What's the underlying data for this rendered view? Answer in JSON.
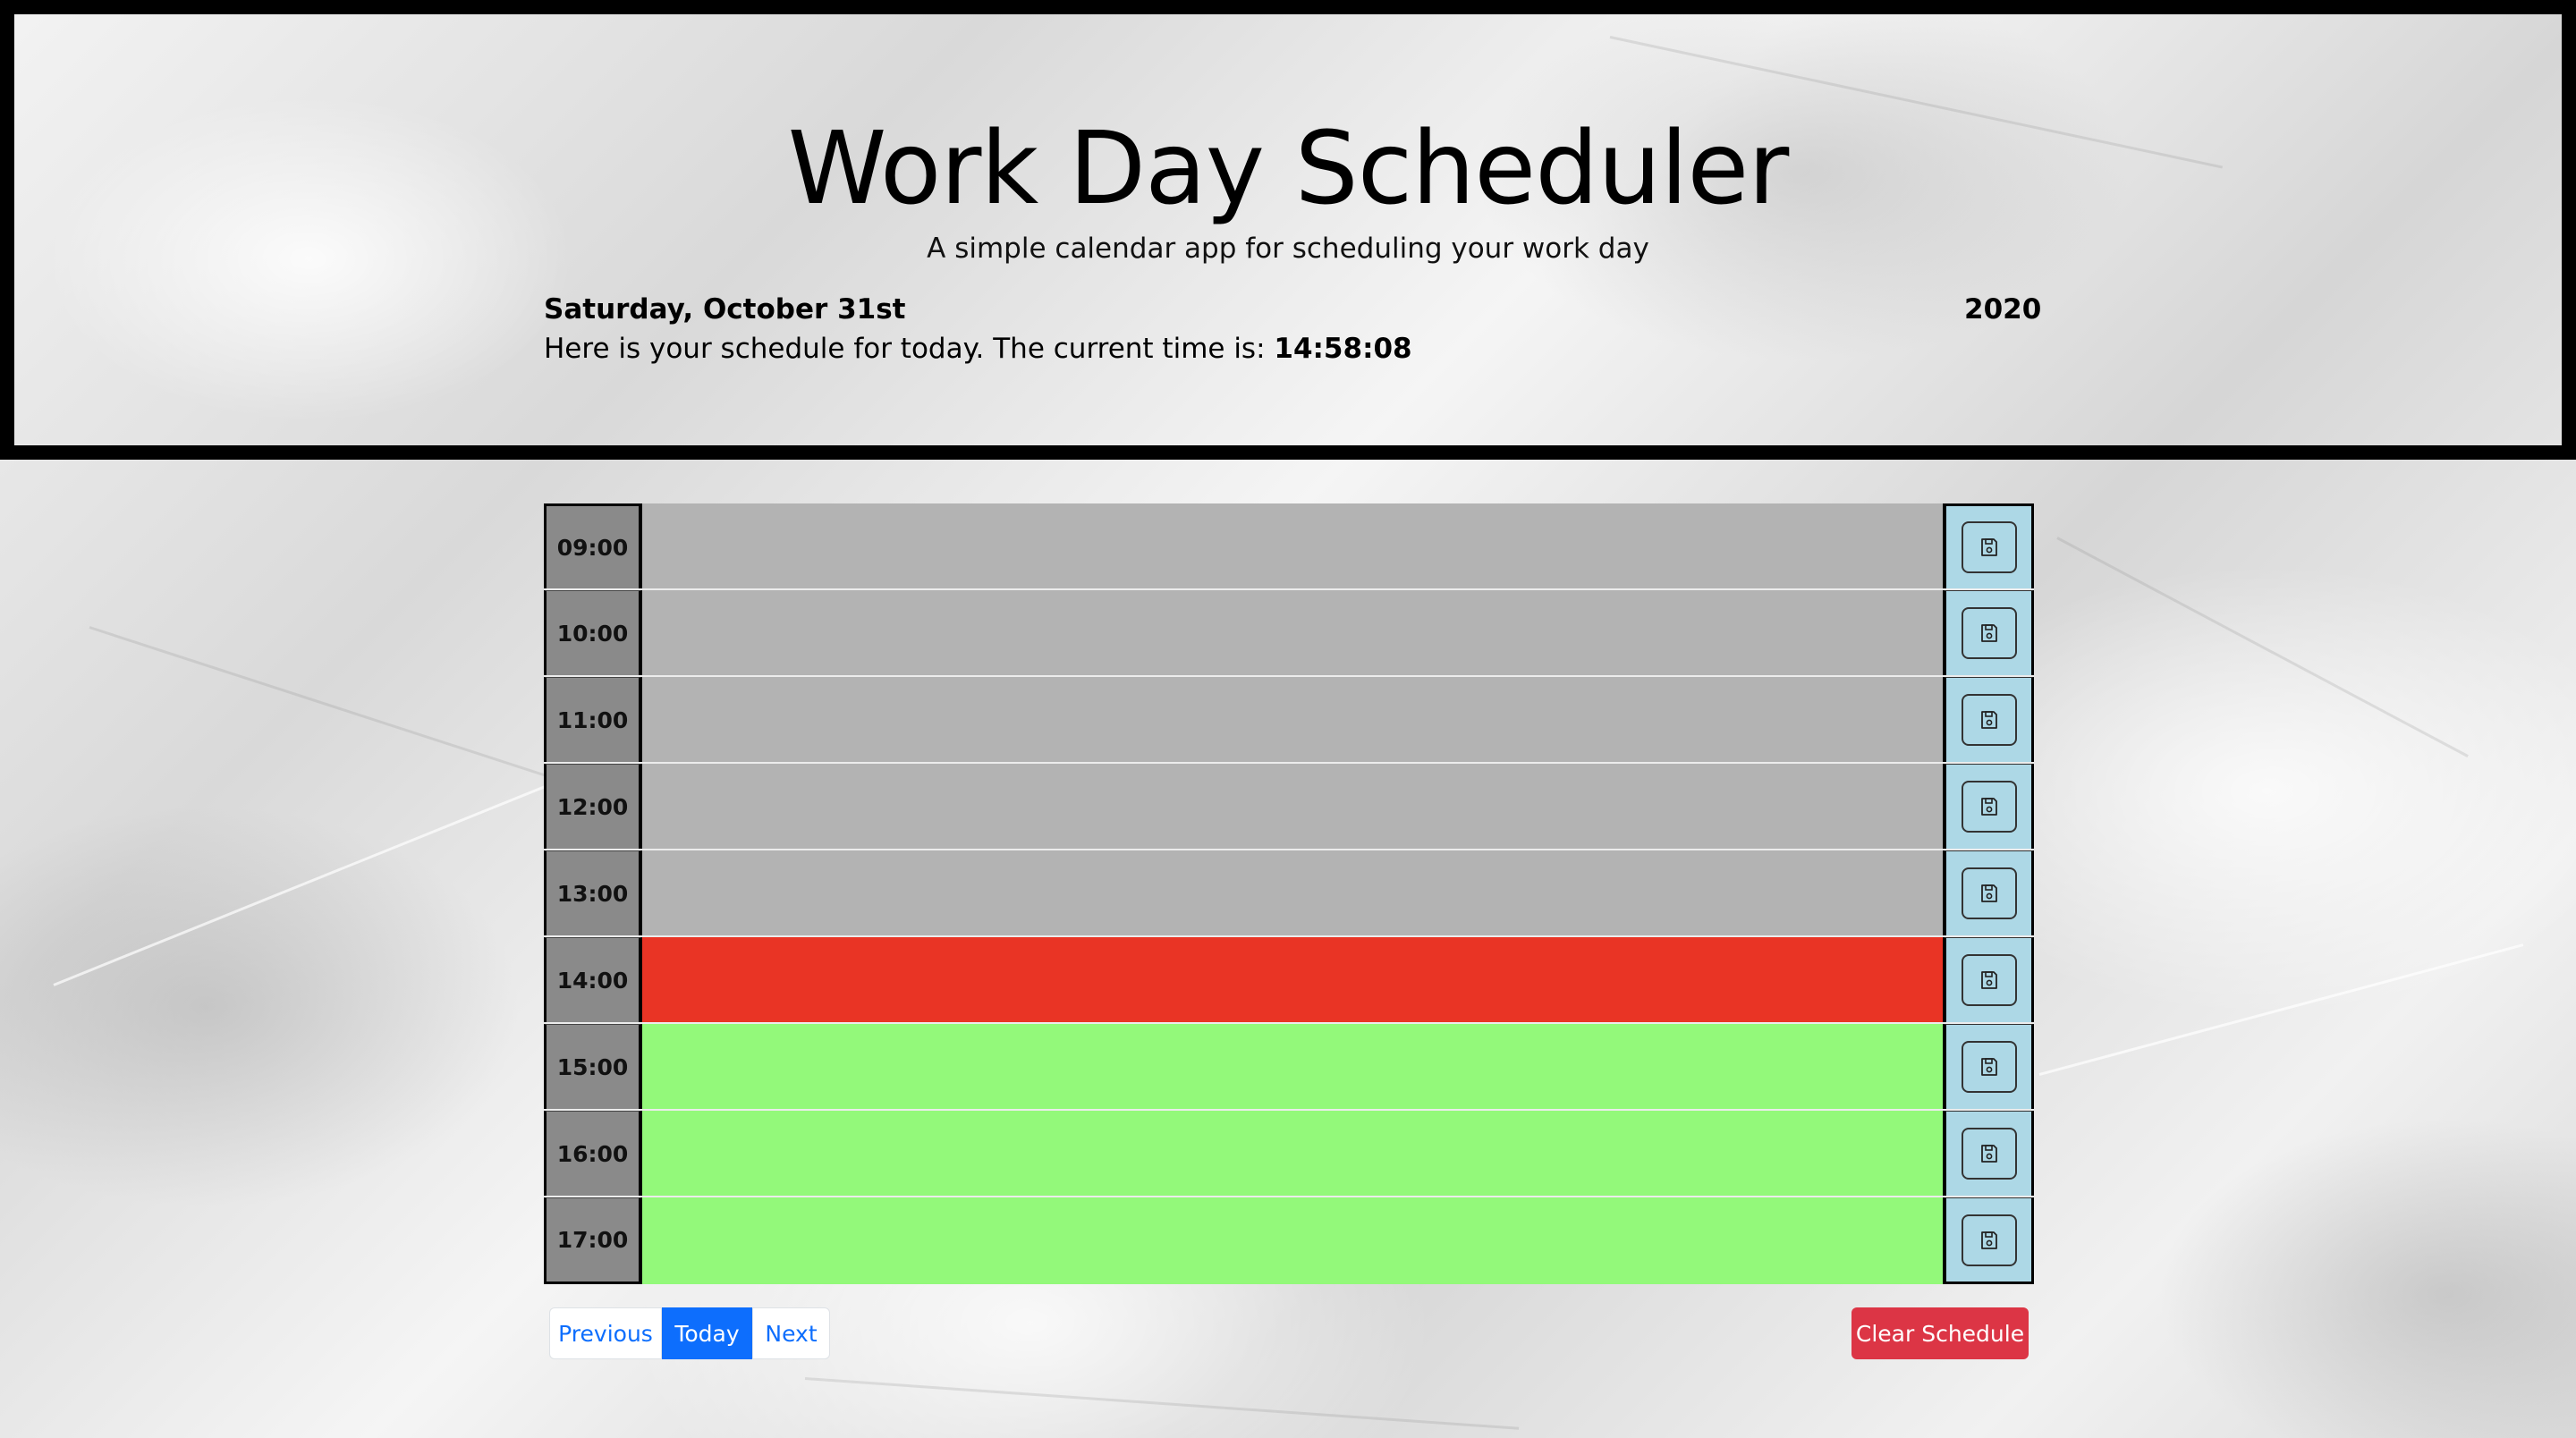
{
  "header": {
    "title": "Work Day Scheduler",
    "lead": "A simple calendar app for scheduling your work day",
    "date": "Saturday, October 31st",
    "year": "2020",
    "schedule_text": "Here is your schedule for today. The current time is:",
    "current_time": "14:58:08"
  },
  "schedule": {
    "rows": [
      {
        "hour": "09:00",
        "status": "past",
        "task": ""
      },
      {
        "hour": "10:00",
        "status": "past",
        "task": ""
      },
      {
        "hour": "11:00",
        "status": "past",
        "task": ""
      },
      {
        "hour": "12:00",
        "status": "past",
        "task": ""
      },
      {
        "hour": "13:00",
        "status": "past",
        "task": ""
      },
      {
        "hour": "14:00",
        "status": "present",
        "task": ""
      },
      {
        "hour": "15:00",
        "status": "future",
        "task": ""
      },
      {
        "hour": "16:00",
        "status": "future",
        "task": ""
      },
      {
        "hour": "17:00",
        "status": "future",
        "task": ""
      }
    ],
    "save_icon": "floppy-disk-icon"
  },
  "pager": {
    "previous": "Previous",
    "today": "Today",
    "next": "Next"
  },
  "clear_button": "Clear Schedule",
  "colors": {
    "past": "#b3b3b3",
    "present": "#e93425",
    "future": "#93f97a",
    "save": "#add8e6",
    "primary": "#0d6efd",
    "danger": "#dc3545"
  }
}
